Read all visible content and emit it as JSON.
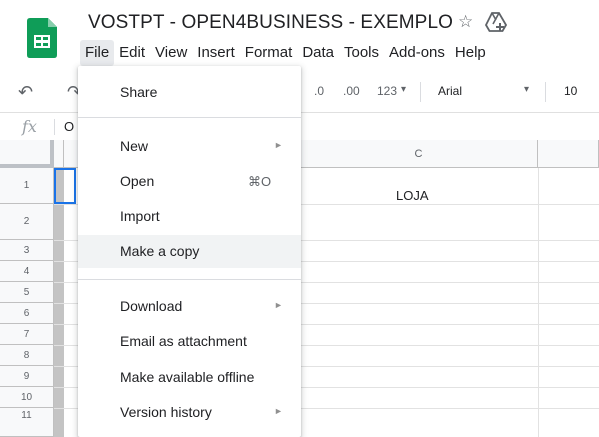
{
  "header": {
    "title": "VOSTPT - OPEN4BUSINESS - EXEMPLO",
    "colors": {
      "sheets_green": "#0f9d58",
      "selection_blue": "#1a73e8"
    }
  },
  "menubar": {
    "items": [
      "File",
      "Edit",
      "View",
      "Insert",
      "Format",
      "Data",
      "Tools",
      "Add-ons",
      "Help"
    ],
    "active": "File"
  },
  "toolbar": {
    "decimal_decrease": ".0",
    "decimal_increase": ".00",
    "more_formats": "123",
    "font": "Arial",
    "font_size": "10"
  },
  "formula_bar": {
    "fx": "fx",
    "value": "O"
  },
  "grid": {
    "column_header": "C",
    "rows": [
      "1",
      "2",
      "3",
      "4",
      "5",
      "6",
      "7",
      "8",
      "9",
      "10",
      "11"
    ],
    "cell_c1": "LOJA"
  },
  "file_menu": {
    "items": [
      {
        "label": "Share"
      },
      {
        "label": "New",
        "submenu": true
      },
      {
        "label": "Open",
        "shortcut": "⌘O"
      },
      {
        "label": "Import"
      },
      {
        "label": "Make a copy",
        "highlighted": true
      },
      {
        "label": "Download",
        "submenu": true
      },
      {
        "label": "Email as attachment"
      },
      {
        "label": "Make available offline"
      },
      {
        "label": "Version history",
        "submenu": true
      }
    ]
  },
  "icons": [
    "sheets-logo-icon",
    "star-icon",
    "drive-move-icon",
    "undo-icon",
    "redo-icon",
    "submenu-arrow-icon",
    "dropdown-arrow-icon"
  ]
}
